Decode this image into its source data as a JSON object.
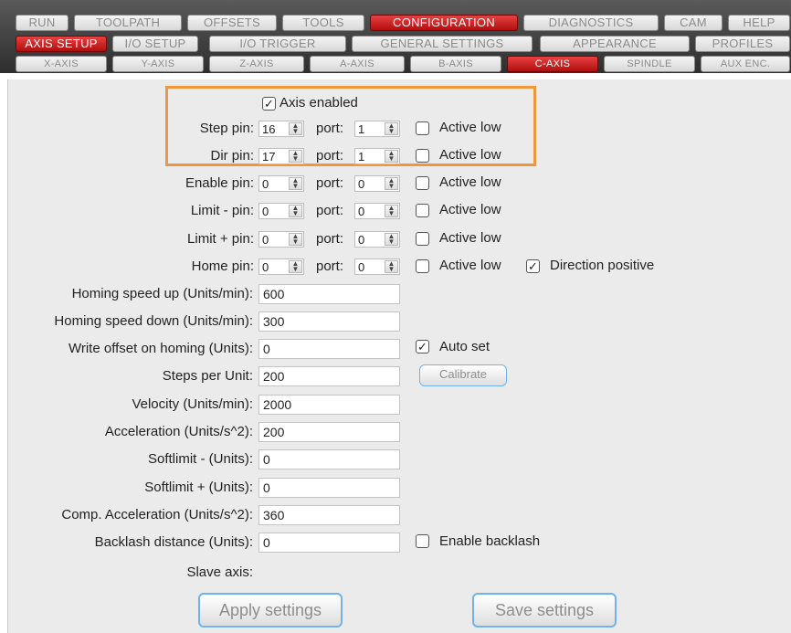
{
  "tabs": {
    "main": [
      "RUN",
      "TOOLPATH",
      "OFFSETS",
      "TOOLS",
      "CONFIGURATION",
      "DIAGNOSTICS",
      "CAM",
      "HELP"
    ],
    "sub": [
      "AXIS SETUP",
      "I/O SETUP",
      "I/O TRIGGER",
      "GENERAL SETTINGS",
      "APPEARANCE",
      "PROFILES"
    ],
    "axes": [
      "X-AXIS",
      "Y-AXIS",
      "Z-AXIS",
      "A-AXIS",
      "B-AXIS",
      "C-AXIS",
      "SPINDLE",
      "AUX ENC."
    ],
    "active_main": "CONFIGURATION",
    "active_sub": "AXIS SETUP",
    "active_axis": "C-AXIS"
  },
  "axis_enabled": {
    "label": "Axis enabled",
    "checked": true
  },
  "pins": [
    {
      "label": "Step pin:",
      "pin": "16",
      "port": "1",
      "active_low": false
    },
    {
      "label": "Dir pin:",
      "pin": "17",
      "port": "1",
      "active_low": false
    },
    {
      "label": "Enable pin:",
      "pin": "0",
      "port": "0",
      "active_low": false
    },
    {
      "label": "Limit - pin:",
      "pin": "0",
      "port": "0",
      "active_low": false
    },
    {
      "label": "Limit + pin:",
      "pin": "0",
      "port": "0",
      "active_low": false
    },
    {
      "label": "Home pin:",
      "pin": "0",
      "port": "0",
      "active_low": false
    }
  ],
  "port_label": "port:",
  "active_low_label": "Active low",
  "direction_positive": {
    "label": "Direction positive",
    "checked": true
  },
  "fields": [
    {
      "label": "Homing speed up (Units/min):",
      "value": "600"
    },
    {
      "label": "Homing speed down (Units/min):",
      "value": "300"
    },
    {
      "label": "Write offset on homing (Units):",
      "value": "0"
    },
    {
      "label": "Steps per Unit:",
      "value": "200"
    },
    {
      "label": "Velocity (Units/min):",
      "value": "2000"
    },
    {
      "label": "Acceleration (Units/s^2):",
      "value": "200"
    },
    {
      "label": "Softlimit - (Units):",
      "value": "0"
    },
    {
      "label": "Softlimit + (Units):",
      "value": "0"
    },
    {
      "label": "Comp. Acceleration (Units/s^2):",
      "value": "360"
    },
    {
      "label": "Backlash distance (Units):",
      "value": "0"
    }
  ],
  "auto_set": {
    "label": "Auto set",
    "checked": true
  },
  "calibrate_label": "Calibrate",
  "enable_backlash": {
    "label": "Enable backlash",
    "checked": false
  },
  "slave_axis_label": "Slave axis:",
  "apply_label": "Apply settings",
  "save_label": "Save settings",
  "colors": {
    "accent": "#c81b1b",
    "highlight": "#f0963c",
    "button_border": "#6fb3e8"
  }
}
